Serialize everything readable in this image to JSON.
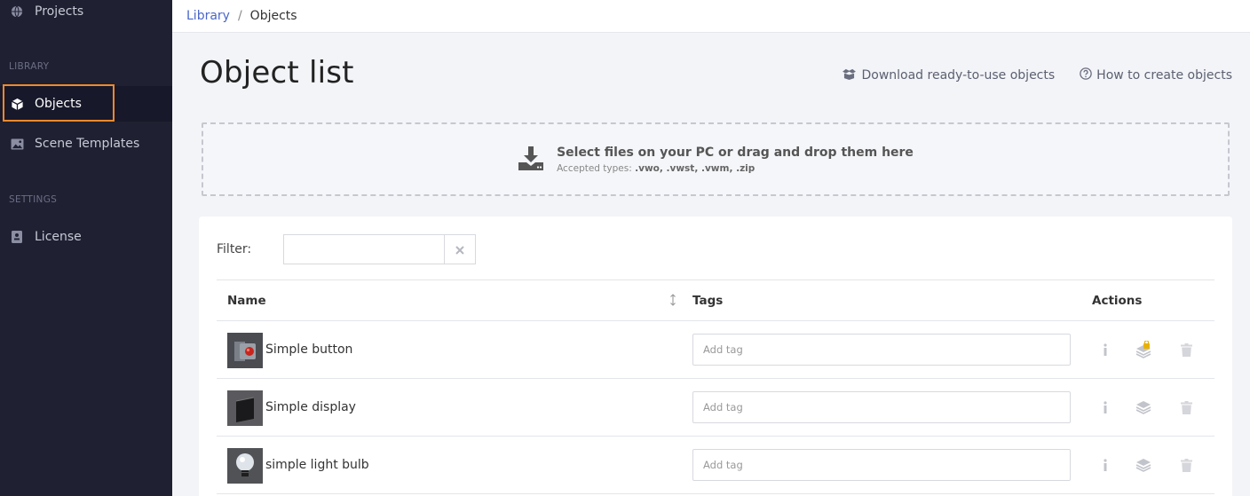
{
  "sidebar": {
    "items": [
      {
        "label": "Projects",
        "icon": "globe-icon"
      },
      {
        "label": "Objects",
        "icon": "cube-icon"
      },
      {
        "label": "Scene Templates",
        "icon": "image-icon"
      },
      {
        "label": "License",
        "icon": "id-badge-icon"
      }
    ],
    "sections": {
      "library": "LIBRARY",
      "settings": "SETTINGS"
    },
    "active_item": "Objects"
  },
  "breadcrumb": {
    "library": "Library",
    "separator": "/",
    "current": "Objects"
  },
  "header": {
    "title": "Object list",
    "download_link": "Download ready-to-use objects",
    "help_link": "How to create objects"
  },
  "dropzone": {
    "title": "Select files on your PC or drag and drop them here",
    "accepted_prefix": "Accepted types: ",
    "accepted_types": ".vwo, .vwst, .vwm, .zip"
  },
  "filter": {
    "label": "Filter:",
    "value": ""
  },
  "table": {
    "columns": {
      "name": "Name",
      "tags": "Tags",
      "actions": "Actions"
    },
    "tag_placeholder": "Add tag",
    "rows": [
      {
        "name": "Simple button",
        "thumb": "button",
        "locked": true
      },
      {
        "name": "Simple display",
        "thumb": "display",
        "locked": false
      },
      {
        "name": "simple light bulb",
        "thumb": "bulb",
        "locked": false
      }
    ]
  },
  "colors": {
    "sidebar_bg": "#1f2031",
    "accent_link": "#4a67c9",
    "highlight": "#f08a2c",
    "lock": "#e8b100"
  }
}
